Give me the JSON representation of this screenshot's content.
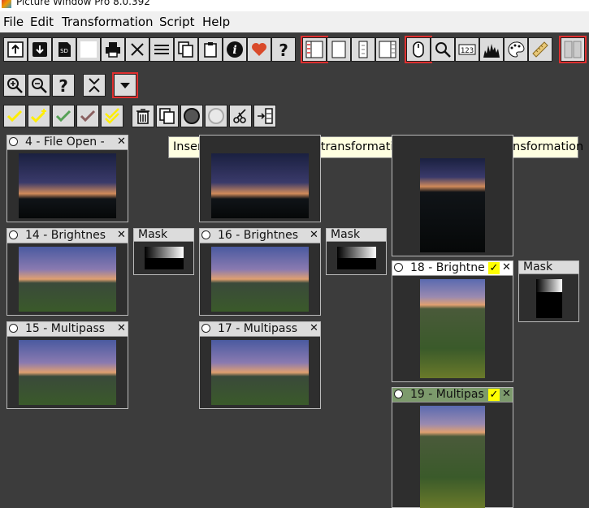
{
  "window": {
    "title": "Picture Window Pro 8.0.392"
  },
  "menu": [
    "File",
    "Edit",
    "Transformation",
    "Script",
    "Help"
  ],
  "tooltip": "Insert copies of selected transformations after current transformation",
  "nodes": [
    {
      "id": "n4",
      "label": "4 - File Open -",
      "check": false
    },
    {
      "id": "n14",
      "label": "14 - Brightnes",
      "check": false
    },
    {
      "id": "n15",
      "label": "15 - Multipass",
      "check": false
    },
    {
      "id": "n16",
      "label": "16 - Brightnes",
      "check": false
    },
    {
      "id": "n17",
      "label": "17 - Multipass",
      "check": false
    },
    {
      "id": "n18",
      "label": "18 - Brightne",
      "check": true
    },
    {
      "id": "n19",
      "label": "19 - Multipas",
      "check": true
    }
  ],
  "masks": [
    "Mask",
    "Mask",
    "Mask"
  ],
  "glyphs": {
    "close": "✕",
    "check": "✓"
  },
  "icons": {
    "toolbar1": [
      "open-file-icon",
      "save-file-icon",
      "sd-card-icon",
      "blank-page-icon",
      "print-icon",
      "close-x-icon",
      "list-icon",
      "copy-icon",
      "clipboard-icon",
      "info-icon",
      "heart-icon",
      "help-icon",
      "panel-layout-1-icon",
      "panel-layout-2-icon",
      "panel-layout-3-icon",
      "panel-layout-4-icon",
      "mouse-icon",
      "magnifier-icon",
      "number-123-icon",
      "histogram-icon",
      "palette-icon",
      "ruler-icon",
      "split-view-icon"
    ],
    "toolbar2": [
      "zoom-in-icon",
      "zoom-out-icon",
      "help-icon",
      "collapse-icon",
      "dropdown-arrow-icon"
    ],
    "toolbar3": [
      "check-yellow-icon",
      "check-yellow-plus-icon",
      "check-green-icon",
      "check-gray-icon",
      "check-double-yellow-icon",
      "trash-icon",
      "copy-transforms-icon",
      "circle-filled-icon",
      "circle-empty-icon",
      "scissors-icon",
      "insert-after-icon"
    ]
  },
  "colors": {
    "accent_red": "#e03030",
    "check_yellow": "#ffff00",
    "current_header": "#7c9a6c",
    "background": "#3c3c3c"
  }
}
